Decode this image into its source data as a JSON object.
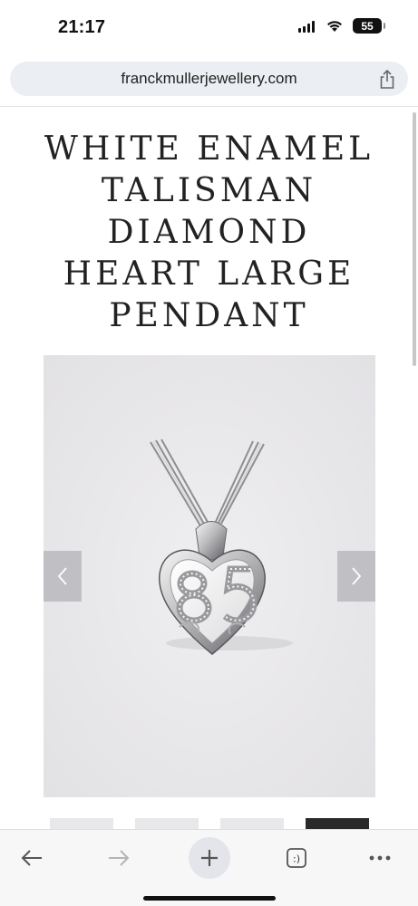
{
  "status_bar": {
    "time": "21:17",
    "battery": "55"
  },
  "browser": {
    "url": "franckmullerjewellery.com"
  },
  "product": {
    "title_lines": [
      "WHITE ENAMEL",
      "TALISMAN",
      "DIAMOND",
      "HEART LARGE",
      "PENDANT"
    ]
  },
  "gallery": {
    "image_name": "white-enamel-heart-pendant-image",
    "thumbnail_count": 4
  },
  "toolbar": {
    "items": [
      "back-icon",
      "forward-icon",
      "new-tab-icon",
      "tabs-icon",
      "more-icon"
    ],
    "tabs_glyph": ":)"
  },
  "colors": {
    "url_bar_bg": "#ebeef2",
    "gallery_bg": "#e8e7e9",
    "title_color": "#222222",
    "toolbar_bg": "#f7f7f8"
  }
}
